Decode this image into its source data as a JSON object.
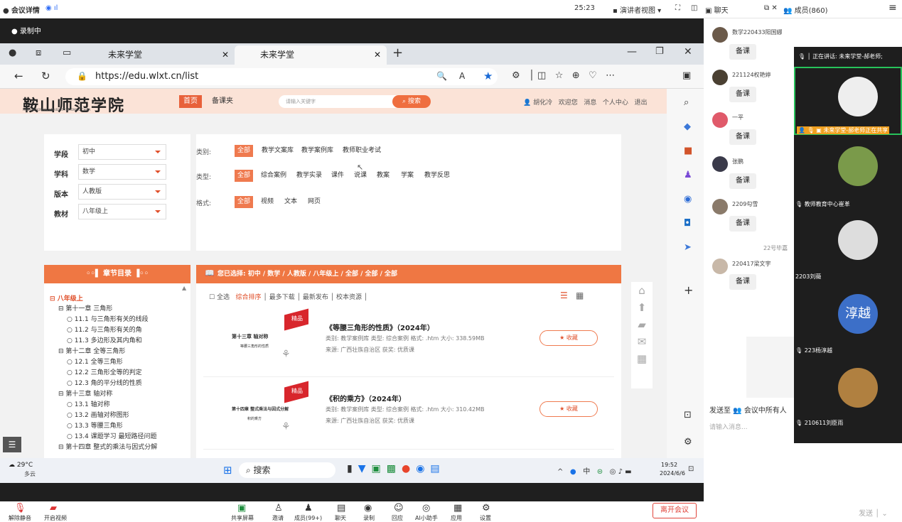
{
  "top": {
    "meeting": "会议详情",
    "timer": "25:23",
    "view": "演讲者视图",
    "chat": "聊天",
    "members": "成员(860)"
  },
  "rec": "录制中",
  "tabs": [
    "未来学堂",
    "未来学堂"
  ],
  "url": "https://edu.wlxt.cn/list",
  "site": {
    "logo": "鞍山师范学院",
    "logosub": "ANSHAN NORMAL UNIVERSITY LIAONING CHINA",
    "home": "首页",
    "prep": "备课夹",
    "search_ph": "请输入关键字",
    "search_btn": "搜索",
    "user": "胡化冷",
    "welcome": "欢迎您",
    "msg": "消息",
    "center": "个人中心",
    "logout": "退出"
  },
  "filters": {
    "l": [
      {
        "k": "学段",
        "v": "初中"
      },
      {
        "k": "学科",
        "v": "数学"
      },
      {
        "k": "版本",
        "v": "人教版"
      },
      {
        "k": "教材",
        "v": "八年级上"
      }
    ],
    "r": [
      {
        "k": "类别:",
        "items": [
          "全部",
          "教学文案库",
          "教学案例库",
          "教师职业考试"
        ]
      },
      {
        "k": "类型:",
        "items": [
          "全部",
          "综合案例",
          "教学实录",
          "课件",
          "说课",
          "教案",
          "学案",
          "教学反思"
        ]
      },
      {
        "k": "格式:",
        "items": [
          "全部",
          "视频",
          "文本",
          "网页"
        ]
      }
    ]
  },
  "chap": {
    "title": "章节目录",
    "items": [
      "八年级上",
      "第十一章  三角形",
      "11.1  与三角形有关的线段",
      "11.2  与三角形有关的角",
      "11.3  多边形及其内角和",
      "第十二章  全等三角形",
      "12.1  全等三角形",
      "12.2  三角形全等的判定",
      "12.3  角的平分线的性质",
      "第十三章  轴对称",
      "13.1  轴对称",
      "13.2  画轴对称图形",
      "13.3  等腰三角形",
      "13.4  课题学习  最短路径问题",
      "第十四章  整式的乘法与因式分解"
    ]
  },
  "res": {
    "header": "您已选择: 初中 / 数学 / 人教版 / 八年级上 / 全部 / 全部 / 全部",
    "sort": [
      "全选",
      "综合排序",
      "最多下载",
      "最新发布",
      "校本资源"
    ],
    "items": [
      {
        "title": "《等腰三角形的性质》（2024年）",
        "meta1": "类别: 教学案例库     类型: 综合案例     格式: .htm     大小: 338.59MB",
        "meta2": "来源: 广西壮族自治区     获奖: 优质课",
        "thumb": "第十三章  轴对称",
        "thumbsub": "等腰三角形的性质",
        "fav": "收藏",
        "badge": "精品"
      },
      {
        "title": "《积的乘方》（2024年）",
        "meta1": "类别: 教学案例库     类型: 综合案例     格式: .htm     大小: 310.42MB",
        "meta2": "来源: 广西壮族自治区     获奖: 优质课",
        "thumb": "第十四章  整式乘法与因式分解",
        "thumbsub": "积的乘方",
        "fav": "收藏",
        "badge": "精品"
      }
    ]
  },
  "taskbar": {
    "weather": "29°C",
    "weather2": "多云",
    "search": "搜索",
    "time": "19:52",
    "date": "2024/6/6"
  },
  "bottom": [
    "解除静音",
    "开启视频",
    "共享屏幕",
    "邀请",
    "成员(99+)",
    "聊天",
    "录制",
    "回应",
    "AI小助手",
    "应用",
    "设置"
  ],
  "leave": "离开会议",
  "send": "发送",
  "chat": {
    "msgs": [
      {
        "n": "数学220433阳国娜",
        "m": "备课"
      },
      {
        "n": "221124权艳婷",
        "m": "备课"
      },
      {
        "n": "一平",
        "m": "备课"
      },
      {
        "n": "张鹏",
        "m": "备课"
      },
      {
        "n": "2209勾雪",
        "m": "备课"
      },
      {
        "n": "220417梁文宇",
        "m": "备课"
      }
    ],
    "partial": "22号毕嘉",
    "sendto": "发送至",
    "all": "会议中所有人",
    "input_ph": "请输入消息..."
  },
  "video": {
    "speaking": "正在讲话: 未来学堂-郝老师;",
    "labels": [
      "未来学堂-郝老师正在共享",
      "教师教育中心崔革",
      "2203刘薇",
      "223杨淳越",
      "210611刘臣雨"
    ],
    "avatar_text": "淳越"
  }
}
